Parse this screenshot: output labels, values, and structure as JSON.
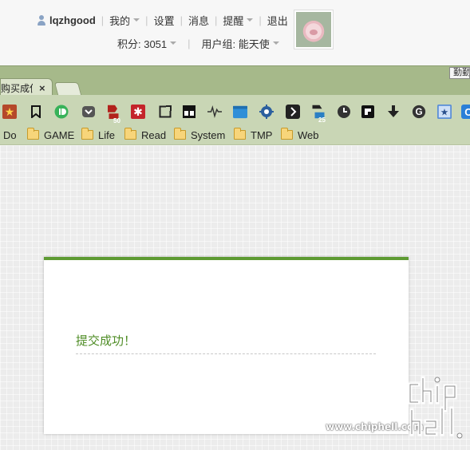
{
  "userbar": {
    "username": "lqzhgood",
    "menu": [
      "我的",
      "设置",
      "消息",
      "提醒",
      "退出"
    ],
    "points_label": "积分: 3051",
    "group_label": "用户组: 能天使"
  },
  "browser": {
    "active_tab_title": "购买成使",
    "corner_label": "勤勤",
    "bookmarks": [
      "Do",
      "GAME",
      "Life",
      "Read",
      "System",
      "TMP",
      "Web"
    ],
    "icon_names": [
      "star-icon",
      "bookmark-icon",
      "reader-icon",
      "pocket-icon",
      "badge-50-icon",
      "asterisk-icon",
      "expand-icon",
      "two-squares-icon",
      "pulse-icon",
      "window-icon",
      "gear-icon",
      "chevron-right-icon",
      "badge-25-icon",
      "clock-icon",
      "square-icon",
      "download-icon",
      "g-icon",
      "star-box-icon",
      "c-icon"
    ],
    "badge_50": "50",
    "badge_25": "25"
  },
  "dialog": {
    "message": "提交成功！"
  },
  "watermark": {
    "url": "www.chiphell.com"
  },
  "colors": {
    "accent_green": "#5e9b33",
    "message_green": "#4f8d26",
    "chrome_green": "#a6b98a"
  }
}
